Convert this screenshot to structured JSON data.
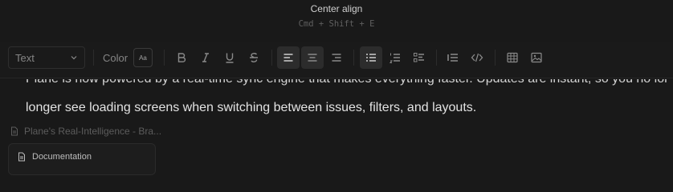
{
  "tooltip": {
    "title": "Center align",
    "shortcut": "Cmd + Shift + E"
  },
  "toolbar": {
    "text_style": "Text",
    "color_label": "Color",
    "color_swatch_glyph": "Aa",
    "buttons": [
      {
        "name": "bold",
        "icon": "bold-icon"
      },
      {
        "name": "italic",
        "icon": "italic-icon"
      },
      {
        "name": "underline",
        "icon": "underline-icon"
      },
      {
        "name": "strikethrough",
        "icon": "strikethrough-icon"
      },
      {
        "name": "align-left",
        "icon": "align-left-icon",
        "active": true
      },
      {
        "name": "align-center",
        "icon": "align-center-icon",
        "active": true
      },
      {
        "name": "align-right",
        "icon": "align-right-icon"
      },
      {
        "name": "bulleted-list",
        "icon": "bulleted-list-icon",
        "active": true
      },
      {
        "name": "numbered-list",
        "icon": "numbered-list-icon"
      },
      {
        "name": "todo-list",
        "icon": "todo-list-icon"
      },
      {
        "name": "quote",
        "icon": "quote-icon"
      },
      {
        "name": "code",
        "icon": "code-icon"
      },
      {
        "name": "table",
        "icon": "table-icon"
      },
      {
        "name": "image",
        "icon": "image-icon"
      }
    ]
  },
  "content": {
    "partial_line": "Plane is now powered by a real-time sync engine that makes everything faster. Updates are instant, so you no longer wait for pages to load as you navigate the app. You",
    "body_line": "longer see loading screens when switching between issues, filters, and layouts.",
    "embed_title": "Plane's Real-Intelligence - Bra...",
    "doc_card_label": "Documentation"
  },
  "colors": {
    "background": "#191919",
    "toolbar_active": "#2c2c2c",
    "text_primary": "#e2e2e2",
    "text_muted": "#858585"
  }
}
